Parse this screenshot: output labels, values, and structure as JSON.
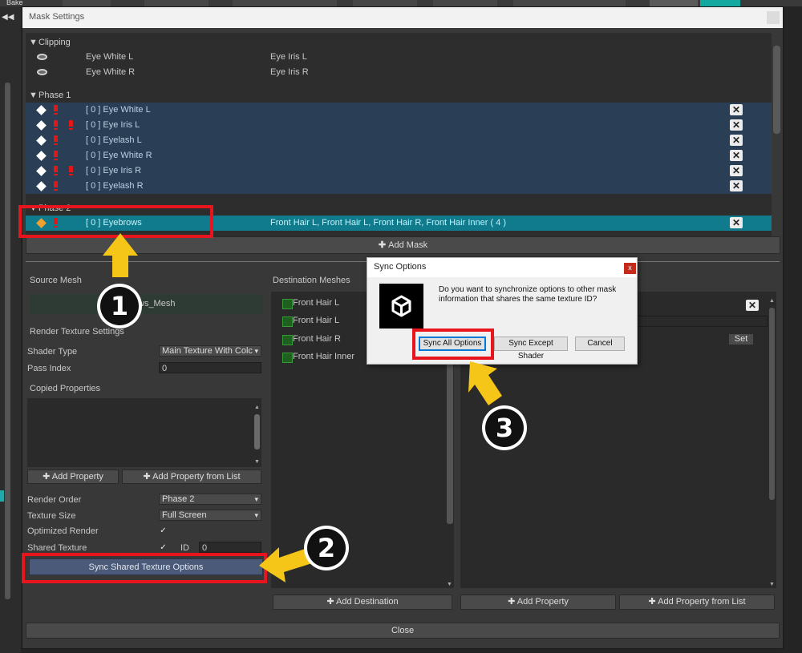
{
  "toolbar": {
    "bake_label": "Bake",
    "collapse_icon": "double-left-arrow-icon"
  },
  "window": {
    "title": "Mask Settings",
    "groups": {
      "clipping": "Clipping",
      "phase1": "Phase 1",
      "phase2": "Phase 2"
    },
    "clipping_rows": [
      {
        "name": "Eye White L",
        "target": "Eye Iris L"
      },
      {
        "name": "Eye White R",
        "target": "Eye Iris R"
      }
    ],
    "phase1_rows": [
      {
        "name": "[ 0 ] Eye White L",
        "second_warning": false
      },
      {
        "name": "[ 0 ] Eye Iris L",
        "second_warning": true
      },
      {
        "name": "[ 0 ] Eyelash L",
        "second_warning": false
      },
      {
        "name": "[ 0 ] Eye White R",
        "second_warning": false
      },
      {
        "name": "[ 0 ] Eye Iris R",
        "second_warning": true
      },
      {
        "name": "[ 0 ] Eyelash R",
        "second_warning": false
      }
    ],
    "phase2_rows": [
      {
        "name": "[ 0 ] Eyebrows",
        "targets": "Front Hair L, Front Hair L, Front Hair R, Front Hair Inner ( 4 )"
      }
    ],
    "remove_symbol": "✕",
    "add_mask": "Add Mask",
    "source_mesh_label": "Source Mesh",
    "source_mesh_value": "ws_Mesh",
    "render_texture_settings": "Render Texture Settings",
    "shader_type_label": "Shader Type",
    "shader_type_value": "Main Texture With Colc",
    "pass_index_label": "Pass Index",
    "pass_index_value": "0",
    "copied_properties_label": "Copied Properties",
    "add_property": "Add Property",
    "add_property_from_list": "Add Property from List",
    "render_order_label": "Render Order",
    "render_order_value": "Phase 2",
    "texture_size_label": "Texture Size",
    "texture_size_value": "Full Screen",
    "optimized_render_label": "Optimized Render",
    "optimized_render_checked": true,
    "shared_texture_label": "Shared Texture",
    "shared_texture_checked": true,
    "id_label": "ID",
    "id_value": "0",
    "sync_shared_button": "Sync Shared Texture Options",
    "destination_meshes_label": "Destination Meshes",
    "destination_meshes": [
      "Front Hair L",
      "Front Hair L",
      "Front Hair R",
      "Front Hair Inner"
    ],
    "add_destination": "Add Destination",
    "set_button": "Set",
    "right_add_property": "Add Property",
    "right_add_property_from_list": "Add Property from List",
    "close_button": "Close"
  },
  "dialog": {
    "title": "Sync Options",
    "close_symbol": "x",
    "message": "Do you want to synchronize options to other mask information that shares the same texture ID?",
    "buttons": {
      "sync_all": "Sync All Options",
      "sync_except_shader": "Sync Except Shader",
      "cancel": "Cancel"
    }
  },
  "annotations": {
    "step1": "1",
    "step2": "2",
    "step3": "3"
  },
  "colors": {
    "highlight_red": "#e8141e",
    "arrow_yellow": "#f5c518",
    "selected_row": "#107b8c",
    "phase_row": "#2a3f55"
  }
}
